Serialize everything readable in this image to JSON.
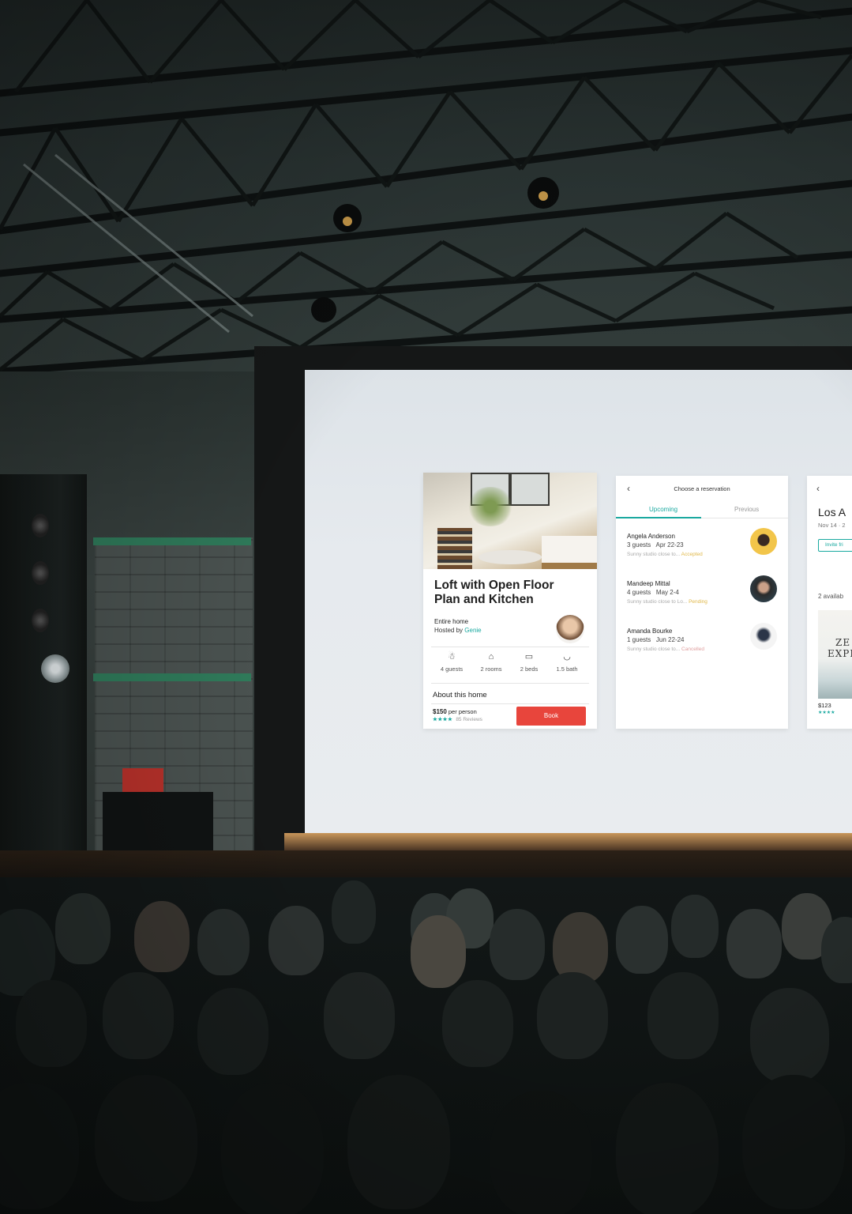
{
  "listing_card": {
    "title_line1": "Loft with Open Floor",
    "title_line2": "Plan and Kitchen",
    "type": "Entire home",
    "hosted_prefix": "Hosted by",
    "host_name": "Genie",
    "amenities": [
      {
        "icon": "guests-icon",
        "label": "4 guests"
      },
      {
        "icon": "rooms-icon",
        "label": "2 rooms"
      },
      {
        "icon": "beds-icon",
        "label": "2 beds"
      },
      {
        "icon": "bath-icon",
        "label": "1.5 bath"
      }
    ],
    "about": "About this home",
    "price": "$150",
    "price_unit": "per person",
    "rating_stars": "★★★★",
    "reviews": "85 Reviews",
    "book_label": "Book",
    "accent": "#1aa9a0",
    "book_color": "#e8453c"
  },
  "reservations_card": {
    "header": "Choose a reservation",
    "tabs": [
      "Upcoming",
      "Previous"
    ],
    "items": [
      {
        "name": "Angela Anderson",
        "guests": "3 guests",
        "dates": "Apr 22-23",
        "note": "Sunny studio close to...",
        "status": "Accepted"
      },
      {
        "name": "Mandeep Mittal",
        "guests": "4 guests",
        "dates": "May 2-4",
        "note": "Sunny studio close to Lo...",
        "status": "Pending"
      },
      {
        "name": "Amanda Bourke",
        "guests": "1 guests",
        "dates": "Jun 22-24",
        "note": "Sunny studio close to...",
        "status": "Cancelled"
      }
    ]
  },
  "third_card": {
    "title": "Los A",
    "date": "Nov 14 · 2",
    "invite": "Invite fri",
    "available": "2 availab",
    "poster_text_1": "ZE",
    "poster_text_2": "EXPLO",
    "price": "$123"
  }
}
